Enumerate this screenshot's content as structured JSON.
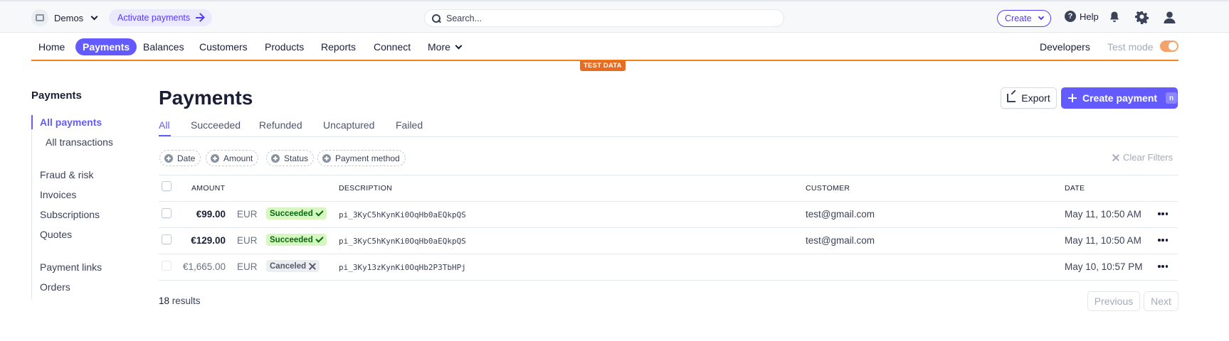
{
  "topbar": {
    "account_name": "Demos",
    "activate_label": "Activate payments",
    "search_placeholder": "Search...",
    "create_label": "Create",
    "help_label": "Help",
    "icons": [
      "bell-icon",
      "gear-icon",
      "user-icon"
    ]
  },
  "nav": {
    "items": [
      {
        "label": "Home"
      },
      {
        "label": "Payments",
        "active": true
      },
      {
        "label": "Balances"
      },
      {
        "label": "Customers"
      },
      {
        "label": "Products"
      },
      {
        "label": "Reports"
      },
      {
        "label": "Connect"
      },
      {
        "label": "More"
      }
    ],
    "developers": "Developers",
    "test_mode": "Test mode",
    "test_mode_on": true,
    "test_badge": "TEST DATA",
    "accent_color": "#635bff",
    "test_color": "#f5821f"
  },
  "sidebar": {
    "title": "Payments",
    "items": [
      {
        "label": "All payments",
        "active": true
      },
      {
        "label": "All transactions"
      },
      {
        "label": "Fraud & risk"
      },
      {
        "label": "Invoices"
      },
      {
        "label": "Subscriptions"
      },
      {
        "label": "Quotes"
      },
      {
        "label": "Payment links"
      },
      {
        "label": "Orders"
      }
    ]
  },
  "main": {
    "title": "Payments",
    "export_label": "Export",
    "create_payment_label": "Create payment",
    "create_payment_shortcut": "n",
    "tabs": [
      "All",
      "Succeeded",
      "Refunded",
      "Uncaptured",
      "Failed"
    ],
    "active_tab": "All",
    "filters": [
      "Date",
      "Amount",
      "Status",
      "Payment method"
    ],
    "clear_filters": "Clear Filters",
    "columns": [
      "AMOUNT",
      "DESCRIPTION",
      "CUSTOMER",
      "DATE"
    ],
    "rows": [
      {
        "amount": "€99.00",
        "currency": "EUR",
        "status": "Succeeded",
        "description": "pi_3KyC5hKynKi0OqHb0aEQkpQS",
        "customer": "test@gmail.com",
        "date": "May 11, 10:50 AM"
      },
      {
        "amount": "€129.00",
        "currency": "EUR",
        "status": "Succeeded",
        "description": "pi_3KyC5hKynKi0OqHb0aEQkpQS",
        "customer": "test@gmail.com",
        "date": "May 11, 10:50 AM"
      },
      {
        "amount": "€1,665.00",
        "currency": "EUR",
        "status": "Canceled",
        "description": "pi_3Ky13zKynKi0OqHb2P3TbHPj",
        "customer": "",
        "date": "May 10, 10:57 PM"
      }
    ],
    "results_count": "18",
    "results_label": "results",
    "previous_label": "Previous",
    "next_label": "Next"
  }
}
